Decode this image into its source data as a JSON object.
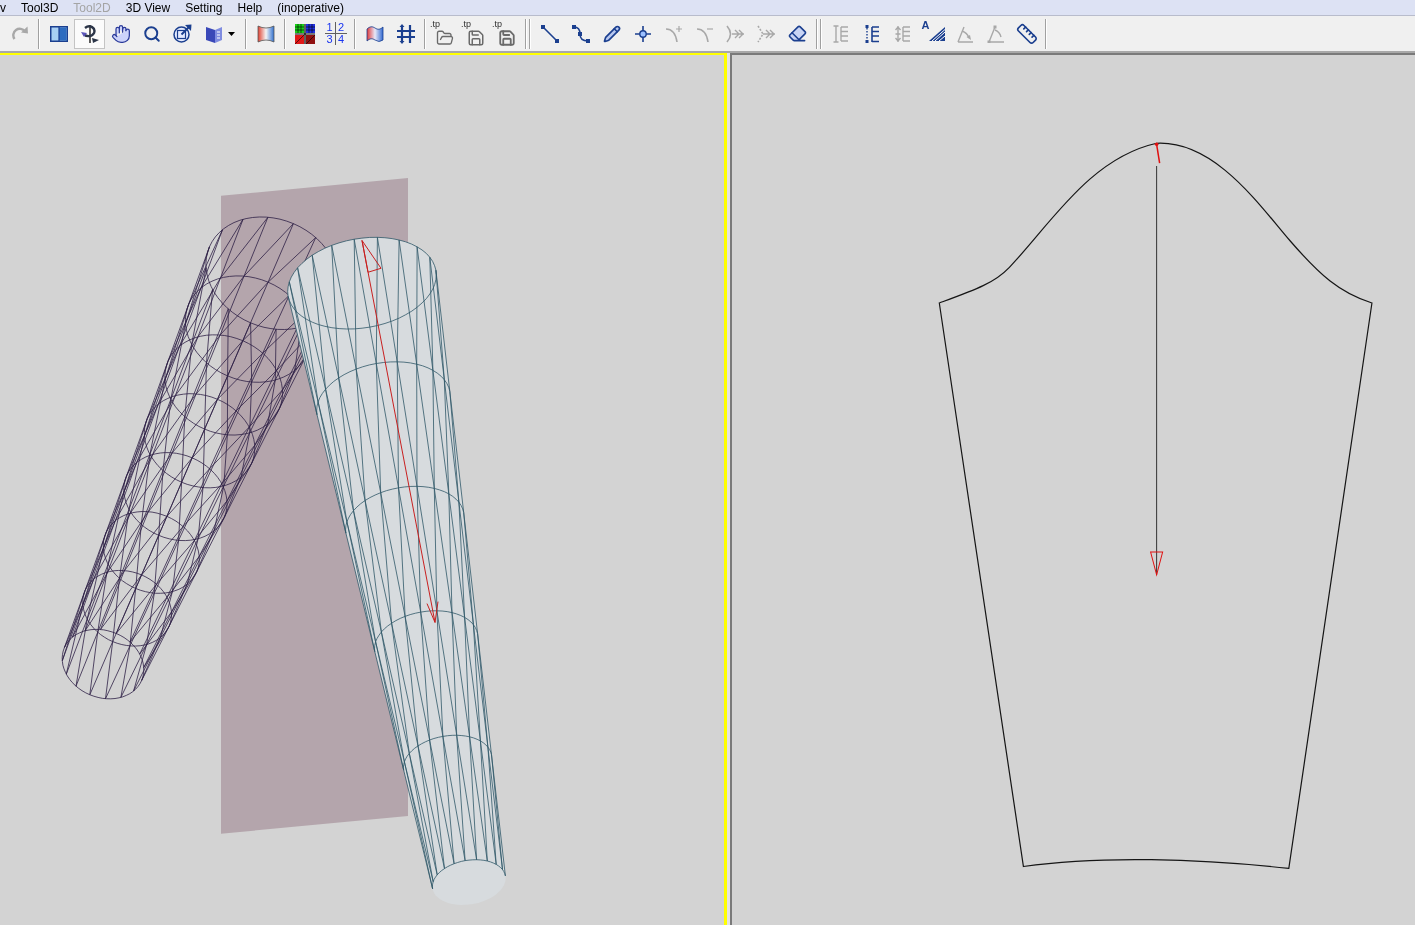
{
  "menu": [
    {
      "label": "v",
      "disabled": false
    },
    {
      "label": "Tool3D",
      "disabled": false
    },
    {
      "label": "Tool2D",
      "disabled": true
    },
    {
      "label": "3D View",
      "disabled": false
    },
    {
      "label": "Setting",
      "disabled": false
    },
    {
      "label": "Help",
      "disabled": false
    },
    {
      "label": "(inoperative)",
      "disabled": false
    }
  ],
  "toolbar": {
    "groups": [
      {
        "double_divider": false,
        "tools": [
          {
            "kind": "redo",
            "disabled": true,
            "selected": false
          }
        ]
      },
      {
        "double_divider": false,
        "tools": [
          {
            "kind": "split",
            "disabled": false,
            "selected": false
          },
          {
            "kind": "rotate",
            "disabled": false,
            "selected": true
          },
          {
            "kind": "hand",
            "disabled": false,
            "selected": false
          },
          {
            "kind": "zoom",
            "disabled": false,
            "selected": false
          },
          {
            "kind": "fit",
            "disabled": false,
            "selected": false
          },
          {
            "kind": "fabric",
            "disabled": false,
            "selected": false,
            "dropdown": true
          }
        ]
      },
      {
        "double_divider": false,
        "tools": [
          {
            "kind": "fabric-color",
            "disabled": false,
            "selected": false
          }
        ]
      },
      {
        "double_divider": false,
        "tools": [
          {
            "kind": "color-grid",
            "disabled": false,
            "selected": false
          },
          {
            "kind": "numbers",
            "disabled": false,
            "selected": false,
            "cells": [
              "1",
              "2",
              "3",
              "4"
            ]
          }
        ]
      },
      {
        "double_divider": false,
        "tools": [
          {
            "kind": "flag",
            "disabled": false,
            "selected": false
          },
          {
            "kind": "grid",
            "disabled": false,
            "selected": false
          }
        ]
      },
      {
        "double_divider": true,
        "tools": [
          {
            "kind": "open",
            "disabled": false,
            "selected": false,
            "label": ".tp"
          },
          {
            "kind": "save",
            "disabled": false,
            "selected": false,
            "label": ".tp"
          },
          {
            "kind": "save-as",
            "disabled": false,
            "selected": false,
            "label": ".tp"
          }
        ]
      },
      {
        "double_divider": true,
        "tools": [
          {
            "kind": "line",
            "disabled": false,
            "selected": false
          },
          {
            "kind": "curve",
            "disabled": false,
            "selected": false
          },
          {
            "kind": "pencil",
            "disabled": false,
            "selected": false
          },
          {
            "kind": "point",
            "disabled": false,
            "selected": false
          },
          {
            "kind": "add-point",
            "disabled": true,
            "selected": false
          },
          {
            "kind": "remove-point",
            "disabled": true,
            "selected": false
          },
          {
            "kind": "merge",
            "disabled": true,
            "selected": false
          },
          {
            "kind": "split-points",
            "disabled": true,
            "selected": false
          },
          {
            "kind": "eraser",
            "disabled": false,
            "selected": false
          }
        ]
      },
      {
        "double_divider": false,
        "tools": [
          {
            "kind": "dimension",
            "disabled": true,
            "selected": false
          },
          {
            "kind": "dimension-dotted",
            "disabled": false,
            "selected": false
          },
          {
            "kind": "dimension-multi",
            "disabled": true,
            "selected": false
          },
          {
            "kind": "hatch",
            "disabled": false,
            "selected": false,
            "label": "A"
          },
          {
            "kind": "angle",
            "disabled": true,
            "selected": false
          },
          {
            "kind": "angle-2",
            "disabled": true,
            "selected": false
          },
          {
            "kind": "ruler",
            "disabled": false,
            "selected": false
          }
        ]
      }
    ]
  },
  "views": [
    {
      "kind": "model",
      "selected": true
    },
    {
      "kind": "pattern",
      "selected": false
    }
  ]
}
